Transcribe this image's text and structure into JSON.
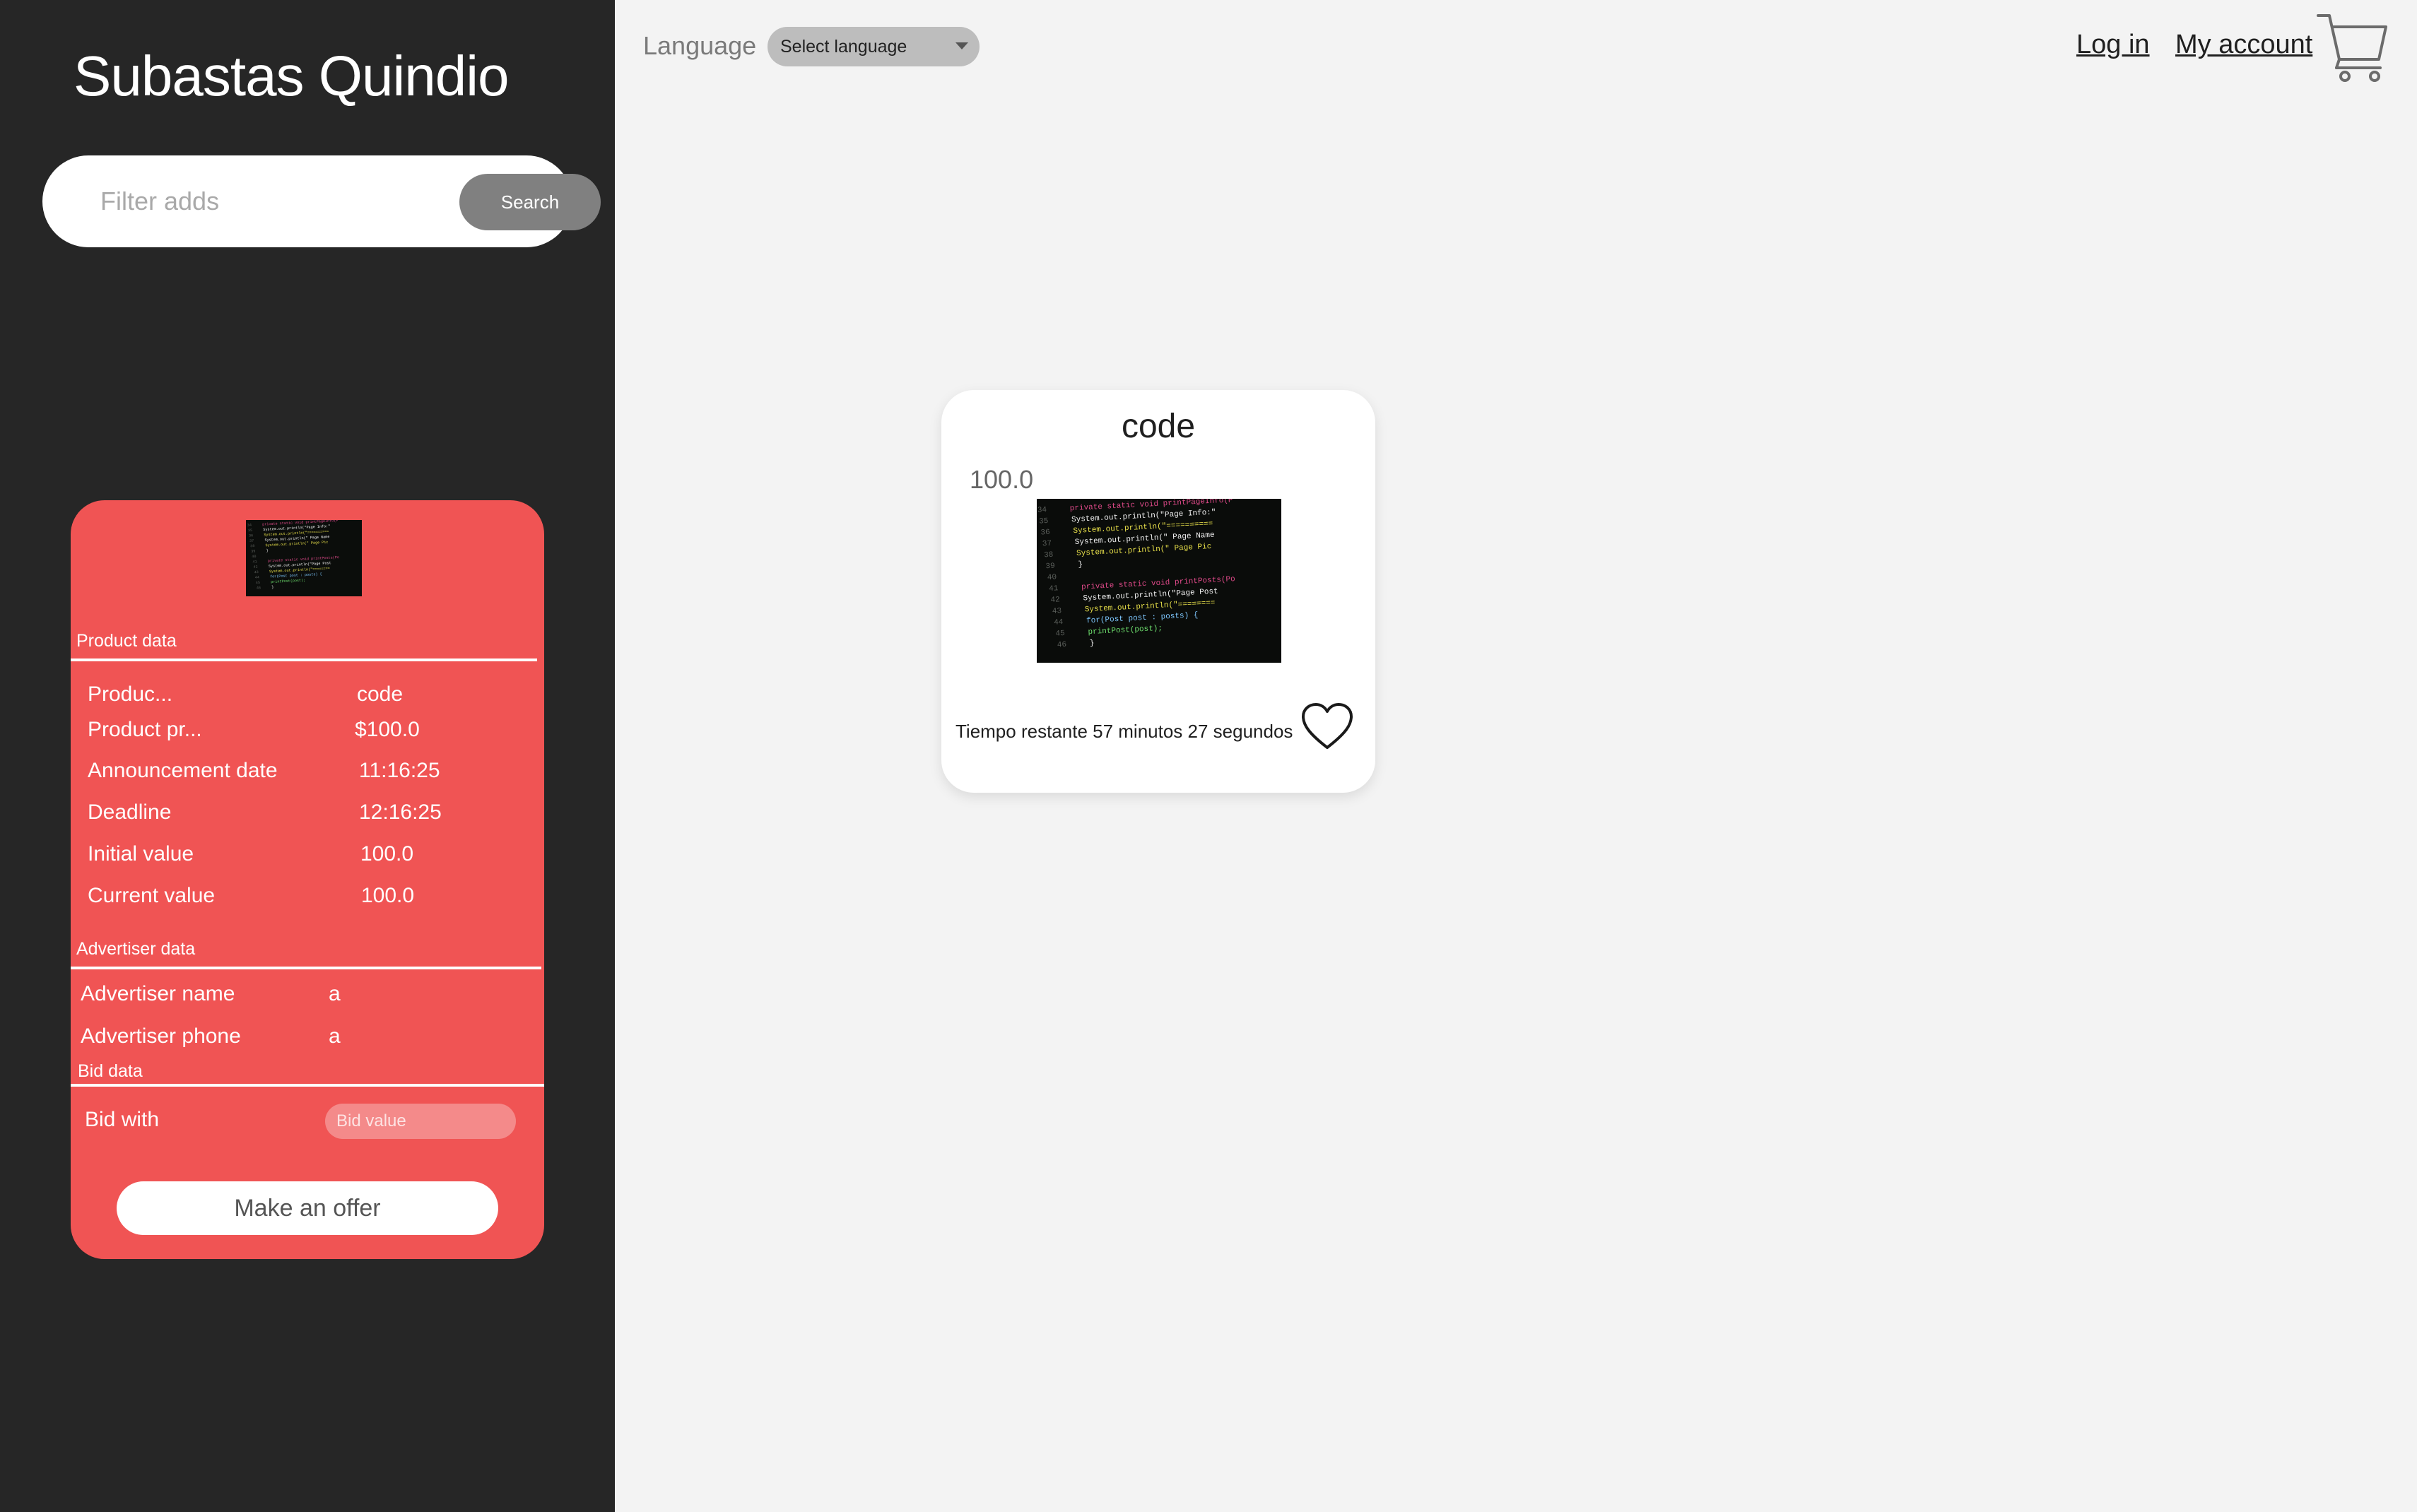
{
  "sidebar": {
    "title": "Subastas Quindio",
    "search": {
      "placeholder": "Filter adds",
      "button_label": "Search"
    }
  },
  "header": {
    "language_label": "Language",
    "language_select": {
      "selected": "Select language"
    },
    "login_label": "Log in",
    "account_label": "My account",
    "cart_icon": "shopping-cart-icon"
  },
  "detail": {
    "image_alt": "code-screenshot",
    "product_section_label": "Product data",
    "rows": [
      {
        "label": "Produc...",
        "value": "code"
      },
      {
        "label": "Product pr...",
        "value": "$100.0"
      },
      {
        "label": "Announcement date",
        "value": "11:16:25"
      },
      {
        "label": "Deadline",
        "value": "12:16:25"
      },
      {
        "label": "Initial value",
        "value": "100.0"
      },
      {
        "label": "Current value",
        "value": "100.0"
      }
    ],
    "advertiser_section_label": "Advertiser data",
    "advertiser_rows": [
      {
        "label": "Advertiser name",
        "value": "a"
      },
      {
        "label": "Advertiser phone",
        "value": "a"
      }
    ],
    "bid_section_label": "Bid data",
    "bid_label": "Bid with",
    "bid_placeholder": "Bid value",
    "offer_button_label": "Make an offer"
  },
  "product_card": {
    "title": "code",
    "price": "100.0",
    "time_remaining": "Tiempo restante 57 minutos 27 segundos",
    "favorite_icon": "heart-icon"
  },
  "code_lines": [
    {
      "num": "34",
      "text": "private static void printPageInfo(P",
      "color": "#e04a8a"
    },
    {
      "num": "35",
      "text": "  System.out.println(\"Page Info:\"",
      "color": "#f2f2f2"
    },
    {
      "num": "36",
      "text": "  System.out.println(\"==========",
      "color": "#e8e04a"
    },
    {
      "num": "37",
      "text": "  System.out.println(\"  Page Name",
      "color": "#f2f2f2"
    },
    {
      "num": "38",
      "text": "  System.out.println(\"  Page Pic",
      "color": "#e8e04a"
    },
    {
      "num": "39",
      "text": "}",
      "color": "#f2f2f2"
    },
    {
      "num": "40",
      "text": "",
      "color": "#f2f2f2"
    },
    {
      "num": "41",
      "text": "private static void printPosts(Po",
      "color": "#e04a8a"
    },
    {
      "num": "42",
      "text": "  System.out.println(\"Page Post",
      "color": "#f2f2f2"
    },
    {
      "num": "43",
      "text": "  System.out.println(\"========",
      "color": "#e8e04a"
    },
    {
      "num": "44",
      "text": "  for(Post post : posts) {",
      "color": "#7ec8ff"
    },
    {
      "num": "45",
      "text": "    printPost(post);",
      "color": "#6ee06e"
    },
    {
      "num": "46",
      "text": "  }",
      "color": "#f2f2f2"
    }
  ],
  "colors": {
    "sidebar_bg": "#262626",
    "detail_card_bg": "#f05454",
    "page_bg": "#f3f3f3",
    "search_button_bg": "#808080"
  }
}
